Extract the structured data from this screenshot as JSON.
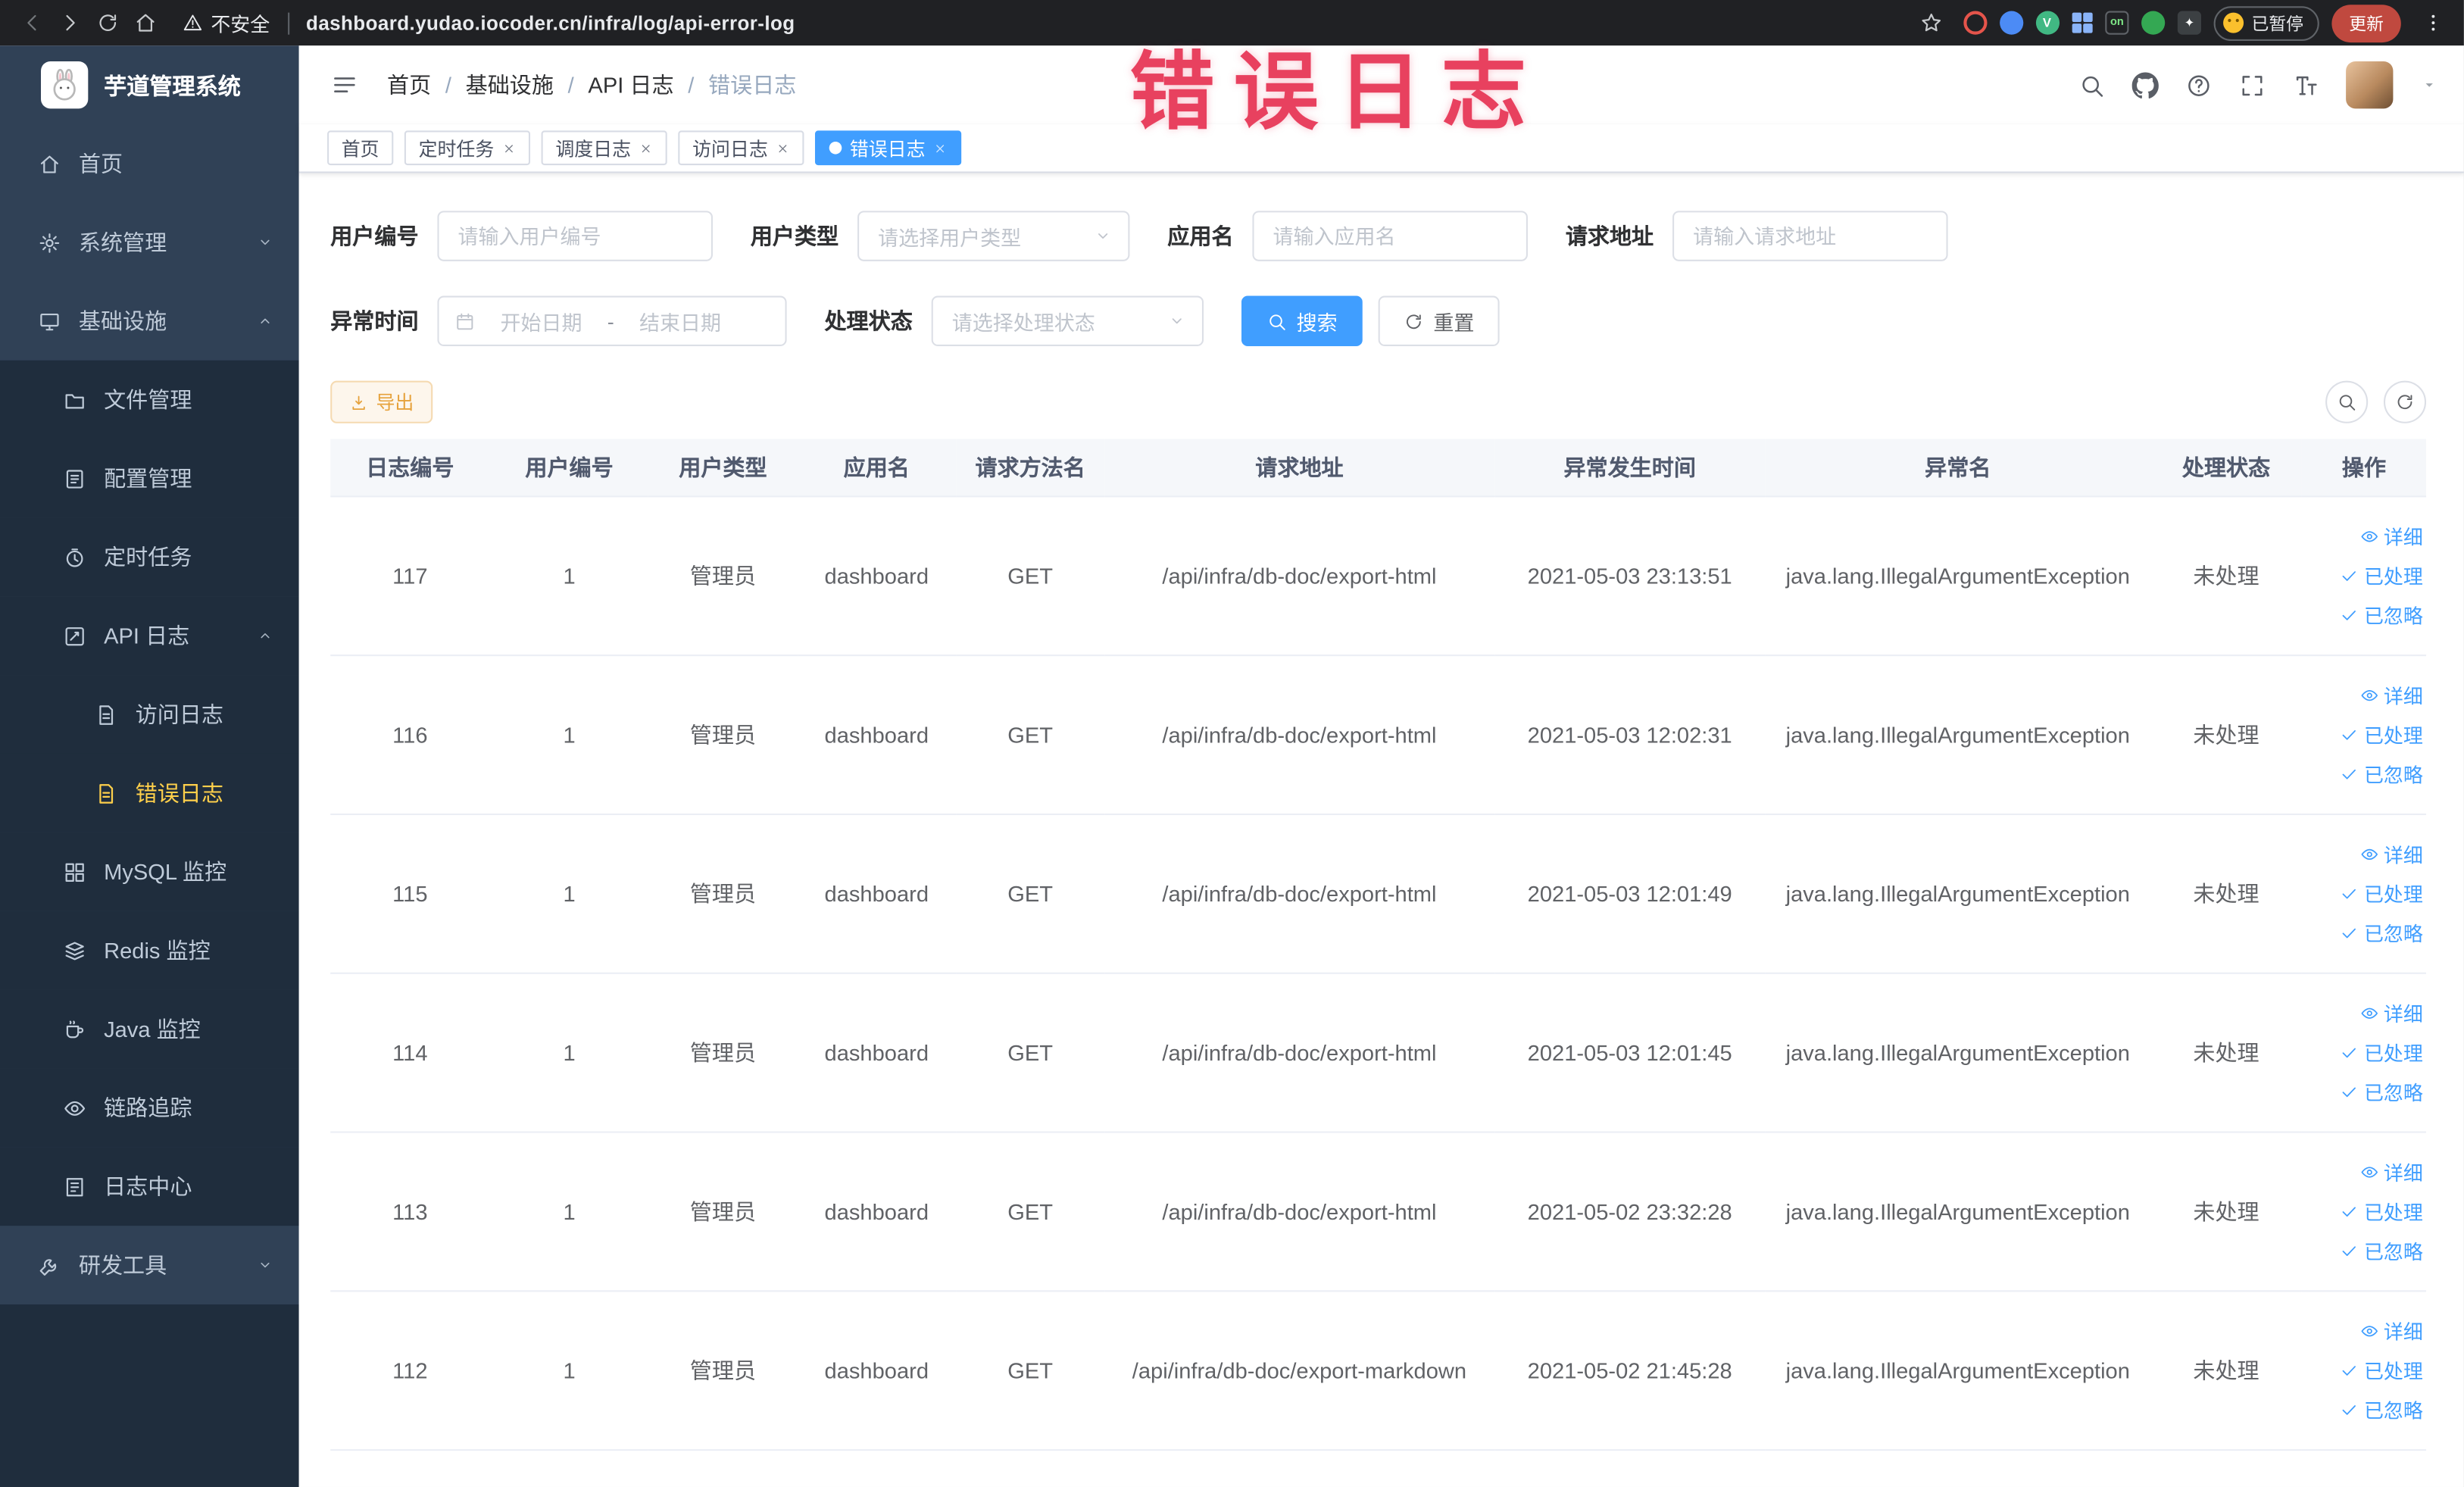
{
  "colors": {
    "accent": "#409eff",
    "sidebar_bg": "#304156",
    "submenu_bg": "#1f2d3d",
    "active_menu_text": "#ffd04b",
    "warning": "#e6a23c",
    "watermark_red": "#e8415f"
  },
  "browser": {
    "security_label": "不安全",
    "url": "dashboard.yudao.iocoder.cn/infra/log/api-error-log",
    "extension_icons": [
      "target",
      "drop",
      "vue",
      "grid",
      "on-badge",
      "leaf",
      "pin"
    ],
    "paused_badge": "已暂停",
    "update_button": "更新"
  },
  "watermark": "错误日志",
  "sidebar": {
    "logo_title": "芋道管理系统",
    "items": [
      {
        "label": "首页",
        "icon": "home-menu",
        "level": 0
      },
      {
        "label": "系统管理",
        "icon": "gear",
        "level": 0,
        "arrow": "down"
      },
      {
        "label": "基础设施",
        "icon": "infra",
        "level": 0,
        "arrow": "up"
      },
      {
        "label": "文件管理",
        "icon": "file",
        "level": 1
      },
      {
        "label": "配置管理",
        "icon": "config",
        "level": 1
      },
      {
        "label": "定时任务",
        "icon": "timer",
        "level": 1
      },
      {
        "label": "API 日志",
        "icon": "api",
        "level": 1,
        "arrow": "up"
      },
      {
        "label": "访问日志",
        "icon": "doc",
        "level": 2
      },
      {
        "label": "错误日志",
        "icon": "doc",
        "level": 2,
        "active": true
      },
      {
        "label": "MySQL 监控",
        "icon": "mysql",
        "level": 1
      },
      {
        "label": "Redis 监控",
        "icon": "redis",
        "level": 1
      },
      {
        "label": "Java 监控",
        "icon": "java",
        "level": 1
      },
      {
        "label": "链路追踪",
        "icon": "trace",
        "level": 1
      },
      {
        "label": "日志中心",
        "icon": "logcenter",
        "level": 1
      },
      {
        "label": "研发工具",
        "icon": "tool",
        "level": 0,
        "arrow": "down"
      }
    ]
  },
  "breadcrumb": {
    "separator": "/",
    "items": [
      "首页",
      "基础设施",
      "API 日志",
      "错误日志"
    ]
  },
  "tags": [
    {
      "label": "首页",
      "closable": false,
      "active": false
    },
    {
      "label": "定时任务",
      "closable": true,
      "active": false
    },
    {
      "label": "调度日志",
      "closable": true,
      "active": false
    },
    {
      "label": "访问日志",
      "closable": true,
      "active": false
    },
    {
      "label": "错误日志",
      "closable": true,
      "active": true
    }
  ],
  "filters": {
    "fields": [
      {
        "label": "用户编号",
        "type": "input",
        "placeholder": "请输入用户编号"
      },
      {
        "label": "用户类型",
        "type": "select",
        "placeholder": "请选择用户类型"
      },
      {
        "label": "应用名",
        "type": "input",
        "placeholder": "请输入应用名"
      },
      {
        "label": "请求地址",
        "type": "input",
        "placeholder": "请输入请求地址"
      },
      {
        "label": "异常时间",
        "type": "daterange",
        "start_placeholder": "开始日期",
        "end_placeholder": "结束日期",
        "separator": "-"
      },
      {
        "label": "处理状态",
        "type": "select",
        "placeholder": "请选择处理状态"
      }
    ],
    "search_label": "搜索",
    "reset_label": "重置"
  },
  "toolbar": {
    "export_label": "导出"
  },
  "table": {
    "columns": [
      "日志编号",
      "用户编号",
      "用户类型",
      "应用名",
      "请求方法名",
      "请求地址",
      "异常发生时间",
      "异常名",
      "处理状态",
      "操作"
    ],
    "actions": {
      "detail": "详细",
      "processed": "已处理",
      "ignored": "已忽略"
    },
    "rows": [
      {
        "cells": [
          "117",
          "1",
          "管理员",
          "dashboard",
          "GET",
          "/api/infra/db-doc/export-html",
          "2021-05-03 23:13:51",
          "java.lang.IllegalArgumentException",
          "未处理"
        ]
      },
      {
        "cells": [
          "116",
          "1",
          "管理员",
          "dashboard",
          "GET",
          "/api/infra/db-doc/export-html",
          "2021-05-03 12:02:31",
          "java.lang.IllegalArgumentException",
          "未处理"
        ]
      },
      {
        "cells": [
          "115",
          "1",
          "管理员",
          "dashboard",
          "GET",
          "/api/infra/db-doc/export-html",
          "2021-05-03 12:01:49",
          "java.lang.IllegalArgumentException",
          "未处理"
        ]
      },
      {
        "cells": [
          "114",
          "1",
          "管理员",
          "dashboard",
          "GET",
          "/api/infra/db-doc/export-html",
          "2021-05-03 12:01:45",
          "java.lang.IllegalArgumentException",
          "未处理"
        ]
      },
      {
        "cells": [
          "113",
          "1",
          "管理员",
          "dashboard",
          "GET",
          "/api/infra/db-doc/export-html",
          "2021-05-02 23:32:28",
          "java.lang.IllegalArgumentException",
          "未处理"
        ]
      },
      {
        "cells": [
          "112",
          "1",
          "管理员",
          "dashboard",
          "GET",
          "/api/infra/db-doc/export-markdown",
          "2021-05-02 21:45:28",
          "java.lang.IllegalArgumentException",
          "未处理"
        ]
      }
    ]
  }
}
